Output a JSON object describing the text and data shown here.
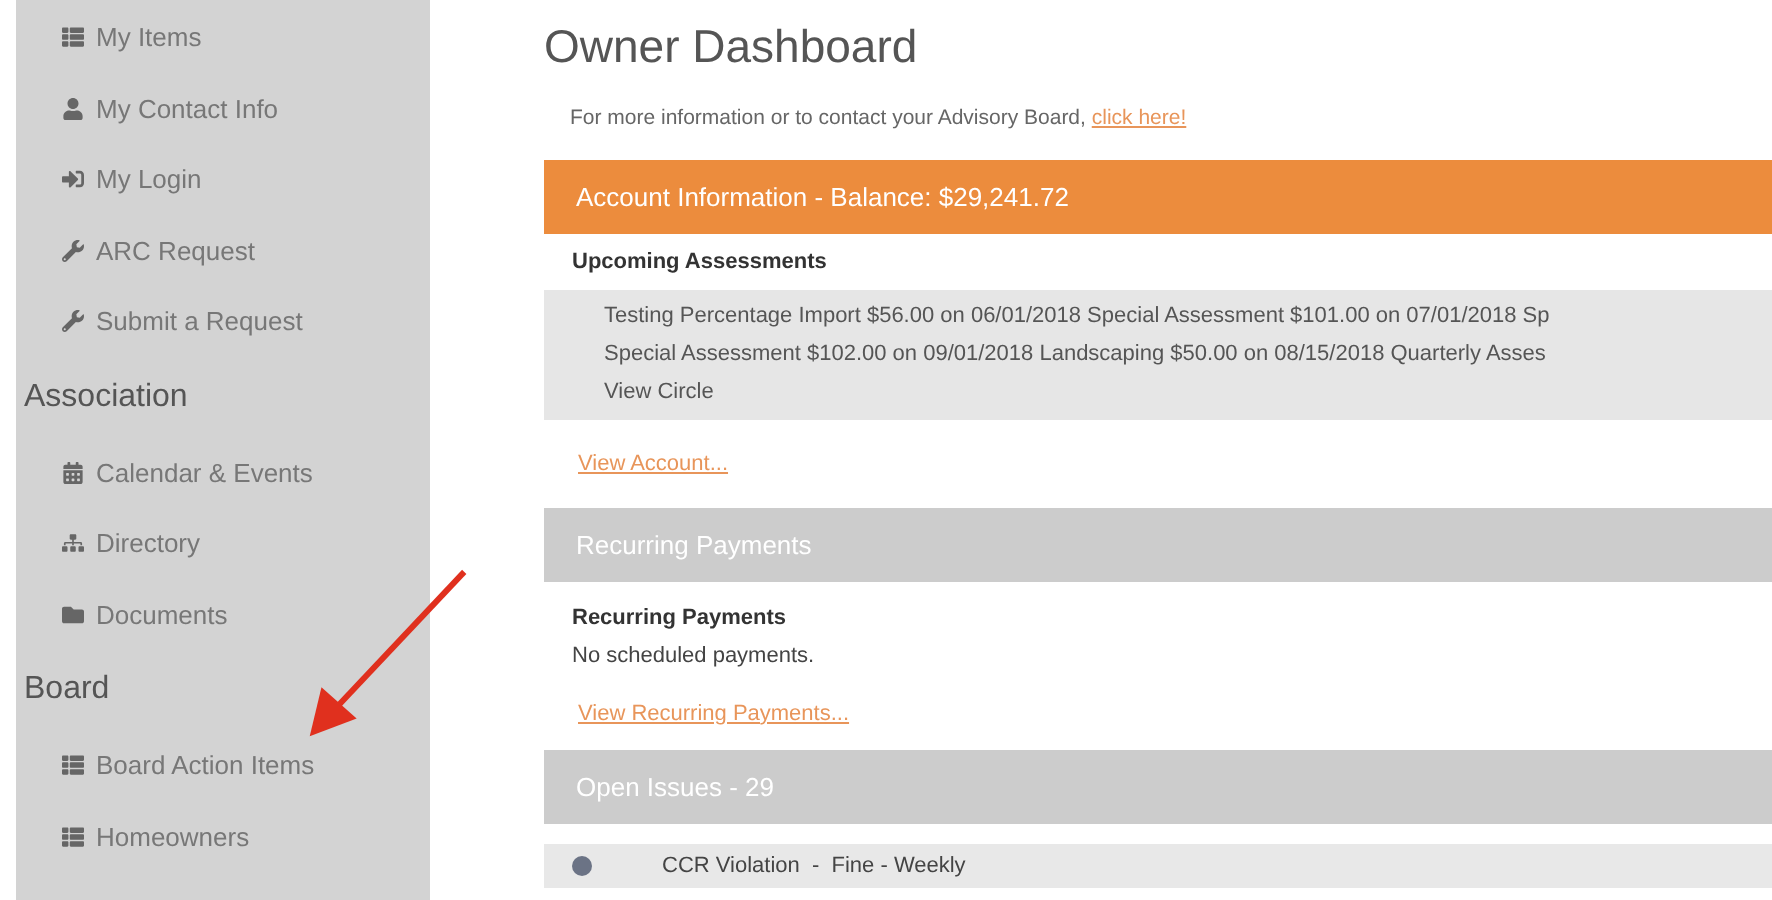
{
  "sidebar": {
    "items": [
      {
        "kind": "item",
        "label": "My Items"
      },
      {
        "kind": "item",
        "label": "My Contact Info"
      },
      {
        "kind": "item",
        "label": "My Login"
      },
      {
        "kind": "item",
        "label": "ARC Request"
      },
      {
        "kind": "item",
        "label": "Submit a Request"
      },
      {
        "kind": "heading",
        "label": "Association"
      },
      {
        "kind": "item",
        "label": "Calendar & Events"
      },
      {
        "kind": "item",
        "label": "Directory"
      },
      {
        "kind": "item",
        "label": "Documents"
      },
      {
        "kind": "heading",
        "label": "Board"
      },
      {
        "kind": "item",
        "label": "Board Action Items"
      },
      {
        "kind": "item",
        "label": "Homeowners"
      }
    ]
  },
  "page": {
    "title": "Owner Dashboard",
    "intro": "For more information or to contact your Advisory Board,",
    "intro_link": "click here!"
  },
  "account_panel": {
    "header": "Account Information - Balance: $29,241.72",
    "subheading": "Upcoming Assessments",
    "assessment_lines": [
      "Testing Percentage Import $56.00 on 06/01/2018 Special Assessment $101.00 on 07/01/2018 Sp",
      "Special Assessment $102.00 on 09/01/2018 Landscaping $50.00 on 08/15/2018 Quarterly Asses",
      "View Circle"
    ],
    "link": "View Account..."
  },
  "recurring_panel": {
    "header": "Recurring Payments",
    "subheading": "Recurring Payments",
    "message": "No scheduled payments.",
    "link": "View Recurring Payments..."
  },
  "issues_panel": {
    "header": "Open Issues - 29",
    "issues": [
      {
        "label": "CCR Violation  -  Fine - Weekly"
      }
    ]
  }
}
